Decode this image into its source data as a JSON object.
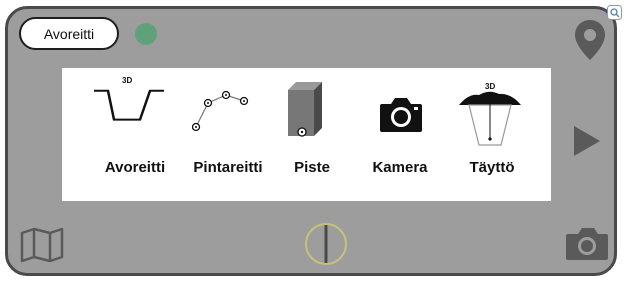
{
  "header": {
    "mode_button_label": "Avoreitti",
    "status_color": "#5fa27a"
  },
  "tools": [
    {
      "id": "avoreitti",
      "label": "Avoreitti",
      "icon": "open-trench-icon",
      "badge": "3D"
    },
    {
      "id": "pintareitti",
      "label": "Pintareitti",
      "icon": "surface-route-icon"
    },
    {
      "id": "piste",
      "label": "Piste",
      "icon": "point-box-icon"
    },
    {
      "id": "kamera",
      "label": "Kamera",
      "icon": "camera-icon"
    },
    {
      "id": "taytto",
      "label": "Täyttö",
      "icon": "fill-icon",
      "badge": "3D"
    }
  ],
  "icons": {
    "top_right": "location-pin-icon",
    "right_middle": "play-icon",
    "bottom_left": "map-icon",
    "bottom_center": "compass-icon",
    "bottom_right": "camera-icon",
    "top_corner_badge": "zoom-icon"
  }
}
